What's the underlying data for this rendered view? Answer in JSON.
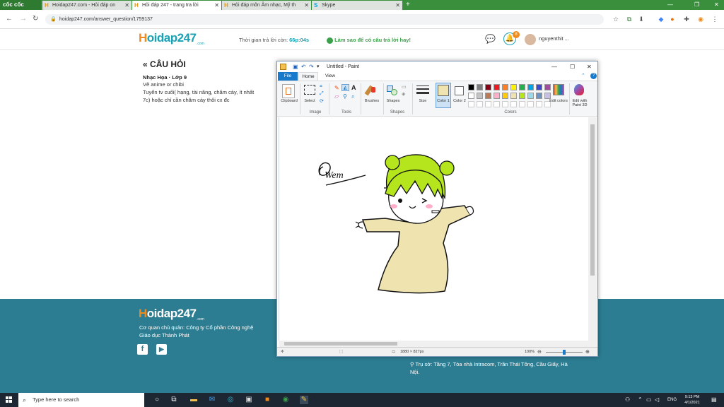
{
  "browser": {
    "brand": "cốc cốc",
    "tabs": [
      {
        "title": "Hoidap247.com - Hỏi đáp on",
        "icon": "hoidap-favicon"
      },
      {
        "title": "Hỏi đáp 247 - trang tra lời",
        "icon": "hoidap-favicon"
      },
      {
        "title": "Hỏi đáp môn Âm nhạc, Mỹ th",
        "icon": "hoidap-favicon"
      },
      {
        "title": "Skype",
        "icon": "skype-icon"
      }
    ],
    "url": "hoidap247.com/answer_question/1759137"
  },
  "site": {
    "logo_h": "H",
    "logo_rest": "oidap247",
    "logo_sub": ".com",
    "timer_label": "Thời gian trả lời còn:",
    "timer_value": "66p:04s",
    "tip": "Làm sao để có câu trả lời hay!",
    "notif_count": "8",
    "username": "nguyenthit ..."
  },
  "question": {
    "heading": "CÂU HỎI",
    "subject": "Nhạc Họa · Lớp 9",
    "lines": [
      "Vẽ anime or chibi",
      "Tuyển tv cuối( hạng, tài năng, chăm cày, ít nhất",
      "7c) hoặc chỉ cần chăm cày thôi cx đc"
    ]
  },
  "footer": {
    "company_1": "Cơ quan chủ quản: Công ty Cổ phần Công nghệ",
    "company_2": "Giáo dục Thành Phát",
    "address_1": "Trụ sở: Tầng 7, Tòa nhà Intracom, Trần Thái Tông, Cầu Giấy, Hà",
    "address_2": "Nội."
  },
  "paint": {
    "title": "Untitled - Paint",
    "menu": [
      "File",
      "Home",
      "View"
    ],
    "tools": {
      "clipboard": "Clipboard",
      "select": "Select",
      "brushes": "Brushes",
      "shapes": "Shapes",
      "size": "Size",
      "color1": "Color 1",
      "color2": "Color 2",
      "edit_colors": "Edit colors",
      "edit_paint3d": "Edit with Paint 3D"
    },
    "groups": {
      "image": "Image",
      "tools": "Tools",
      "shapes": "Shapes",
      "colors": "Colors"
    },
    "palette": [
      "#000000",
      "#7f7f7f",
      "#880015",
      "#ed1c24",
      "#ff7f27",
      "#fff200",
      "#22b14c",
      "#00a2e8",
      "#3f48cc",
      "#a349a4",
      "#ffffff",
      "#c3c3c3",
      "#b97a57",
      "#ffaec9",
      "#ffc90e",
      "#efe4b0",
      "#b5e61d",
      "#99d9ea",
      "#7092be",
      "#c8bfe7"
    ],
    "color1": "#efe4b0",
    "canvas_size": "1880 × 827px",
    "zoom": "100%",
    "signature_text": "Wem"
  },
  "taskbar": {
    "search_placeholder": "Type here to search",
    "lang": "ENG",
    "time": "9:13 PM",
    "date": "4/1/2021"
  }
}
